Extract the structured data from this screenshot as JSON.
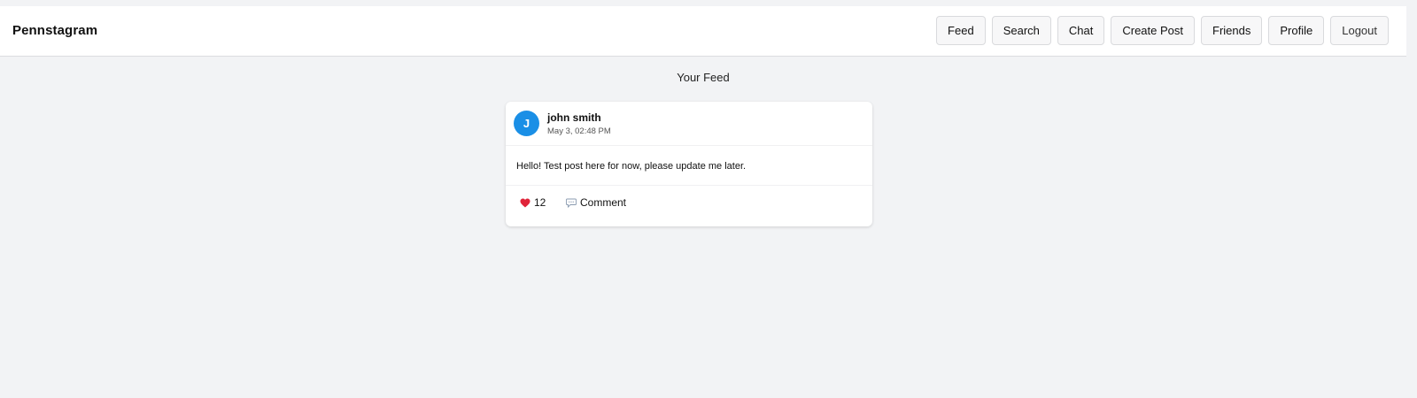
{
  "app": {
    "brand": "Pennstagram"
  },
  "nav": {
    "items": [
      {
        "label": "Feed"
      },
      {
        "label": "Search"
      },
      {
        "label": "Chat"
      },
      {
        "label": "Create Post"
      },
      {
        "label": "Friends"
      },
      {
        "label": "Profile"
      },
      {
        "label": "Logout"
      }
    ]
  },
  "feed": {
    "title": "Your Feed",
    "posts": [
      {
        "avatar_initial": "J",
        "avatar_color": "#1a8fe6",
        "author": "john smith",
        "timestamp": "May 3, 02:48 PM",
        "text": "Hello! Test post here for now, please update me later.",
        "likes": "12",
        "like_icon": "heart-icon",
        "like_color": "#e0243a",
        "comment_label": "Comment",
        "comment_icon": "speech-bubble-icon"
      }
    ]
  }
}
